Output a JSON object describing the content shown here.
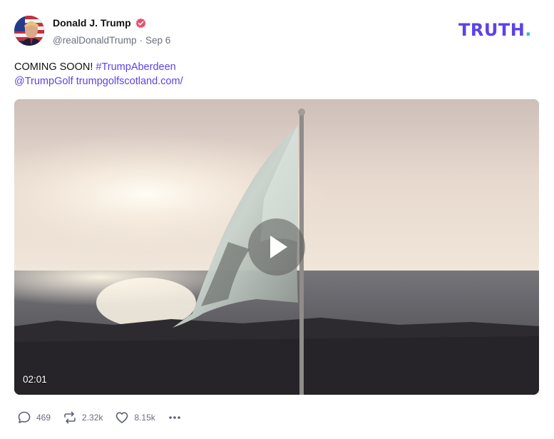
{
  "post": {
    "author_name": "Donald J. Trump",
    "handle": "@realDonaldTrump",
    "separator": "·",
    "date": "Sep 6",
    "text_prefix": "COMING SOON! ",
    "hashtag": "#TrumpAberdeen",
    "mention": "@TrumpGolf",
    "url_text": "trumpgolfscotland.com/",
    "video_duration": "02:01"
  },
  "brand": {
    "logo_main": "TRUTH",
    "logo_period": ".",
    "accent_color": "#5b43e8",
    "secondary_color": "#25c6b3"
  },
  "actions": {
    "replies": "469",
    "retruths": "2.32k",
    "likes": "8.15k"
  },
  "icons": {
    "verified": "verified-badge-icon",
    "play": "play-icon",
    "reply": "reply-icon",
    "retruth": "retruth-icon",
    "like": "heart-icon",
    "more": "more-icon"
  }
}
